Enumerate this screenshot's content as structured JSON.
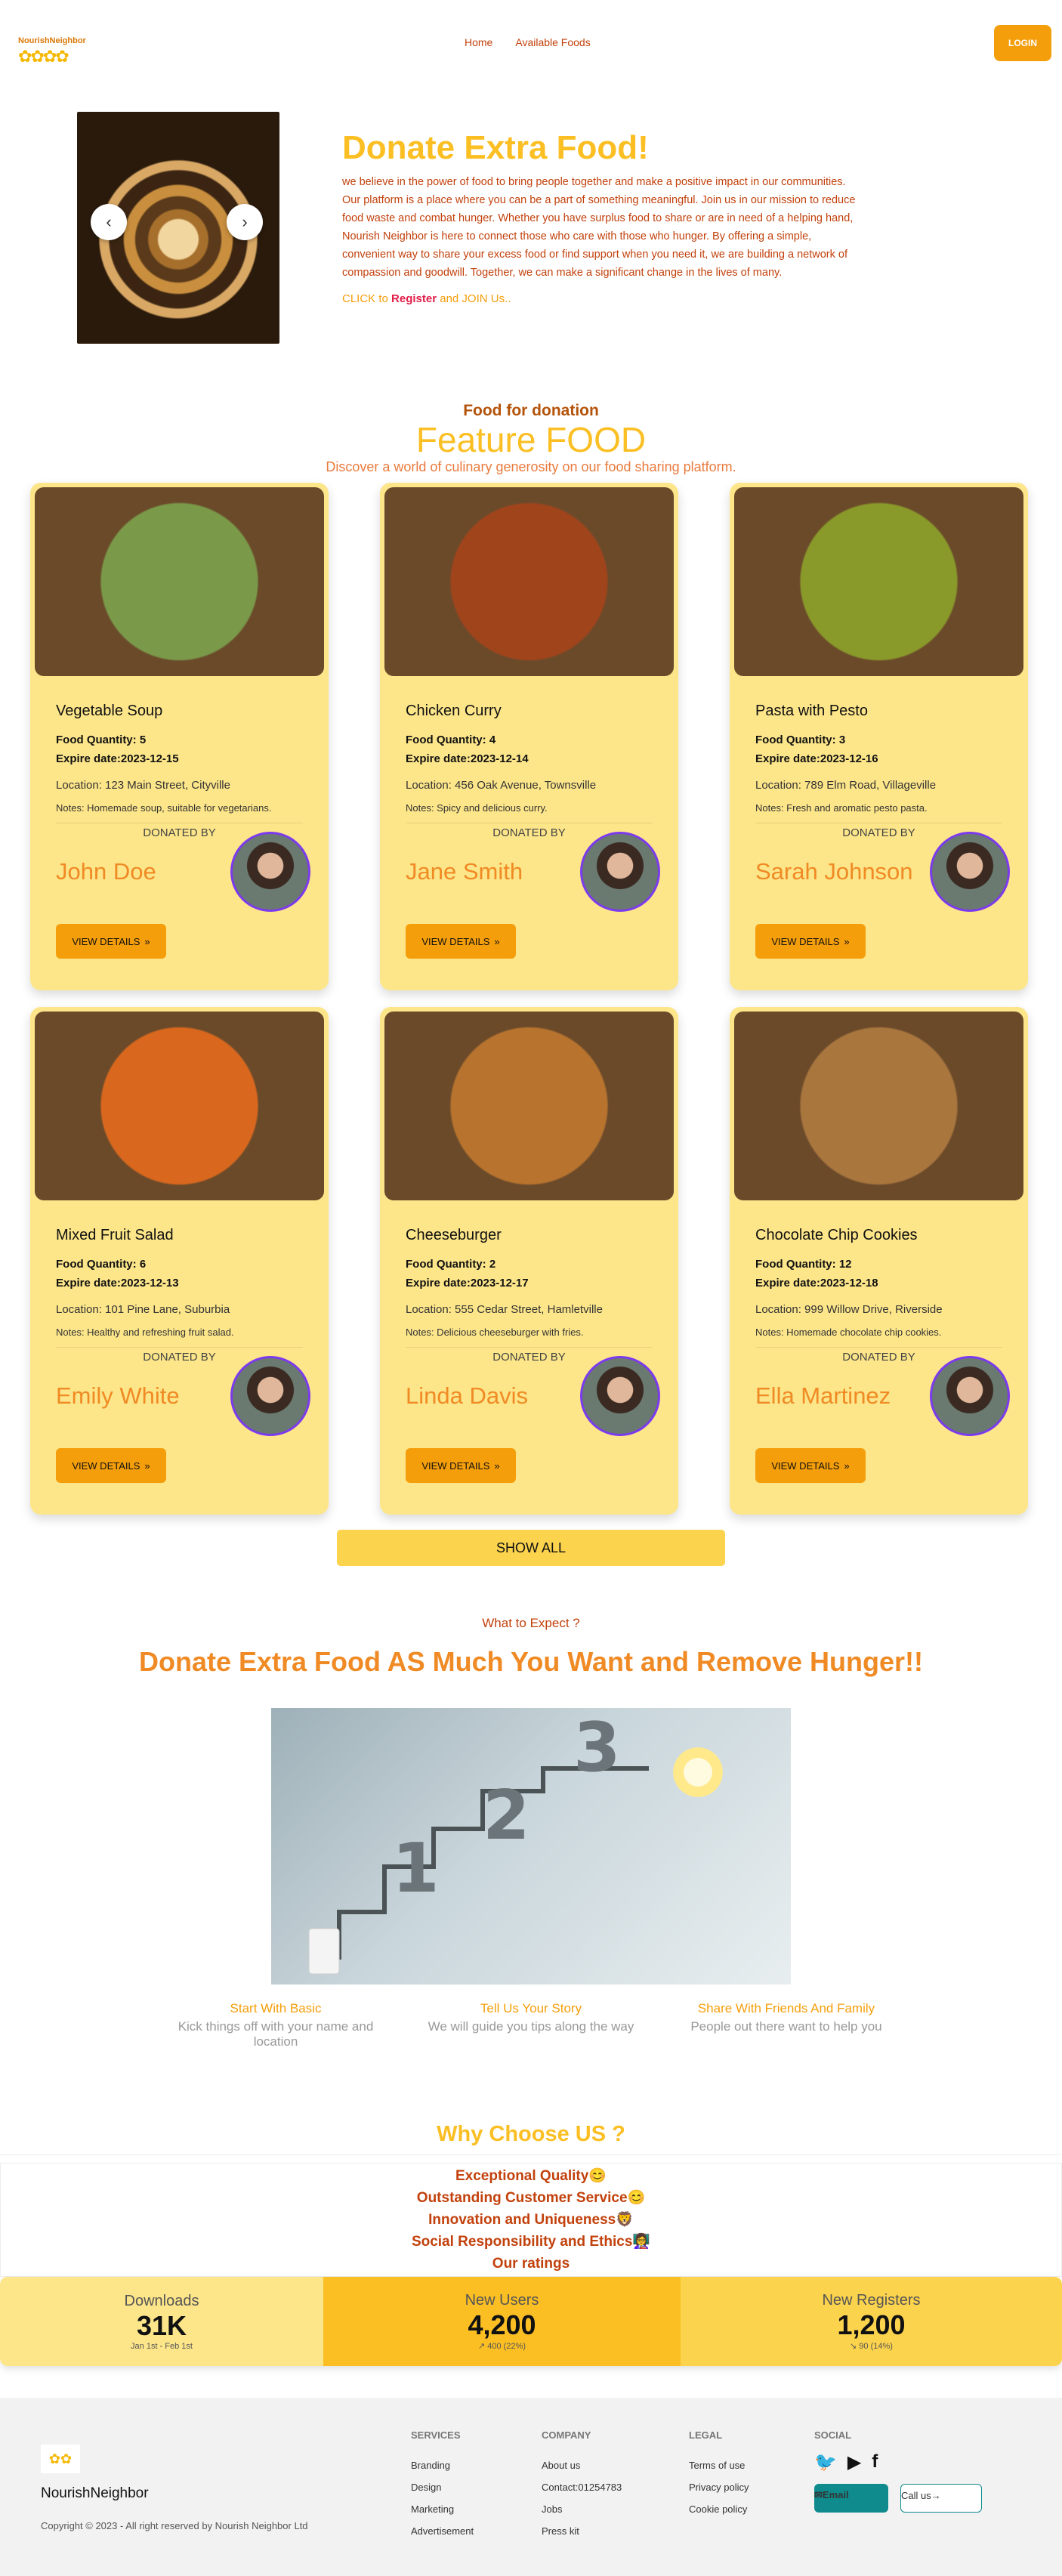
{
  "nav": {
    "logo_text": "NourishNeighbor",
    "links": [
      "Home",
      "Available Foods"
    ],
    "login_label": "LOGIN"
  },
  "hero": {
    "prev": "‹",
    "next": "›",
    "title": "Donate Extra Food!",
    "paragraph": "we believe in the power of food to bring people together and make a positive impact in our communities. Our platform is a place where you can be a part of something meaningful. Join us in our mission to reduce food waste and combat hunger. Whether you have surplus food to share or are in need of a helping hand, Nourish Neighbor is here to connect those who care with those who hunger. By offering a simple, convenient way to share your excess food or find support when you need it, we are building a network of compassion and goodwill. Together, we can make a significant change in the lives of many.",
    "cta_prefix": "CLICK to ",
    "cta_register": "Register",
    "cta_suffix": " and JOIN Us.."
  },
  "featured": {
    "kicker": "Food for donation",
    "title": "Feature FOOD",
    "description": "Discover a world of culinary generosity on our food sharing platform.",
    "donated_by_label": "DONATED BY",
    "view_details_label": "VIEW DETAILS",
    "show_all_label": "SHOW ALL",
    "foods": [
      {
        "name": "Vegetable Soup",
        "quantity": "5",
        "expire": "2023-12-15",
        "location": "Location: 123 Main Street, Cityville",
        "notes": "Notes: Homemade soup, suitable for vegetarians.",
        "donor": "John Doe",
        "img_color": "#7a9a4a"
      },
      {
        "name": "Chicken Curry",
        "quantity": "4",
        "expire": "2023-12-14",
        "location": "Location: 456 Oak Avenue, Townsville",
        "notes": "Notes: Spicy and delicious curry.",
        "donor": "Jane Smith",
        "img_color": "#a0441c"
      },
      {
        "name": "Pasta with Pesto",
        "quantity": "3",
        "expire": "2023-12-16",
        "location": "Location: 789 Elm Road, Villageville",
        "notes": "Notes: Fresh and aromatic pesto pasta.",
        "donor": "Sarah Johnson",
        "img_color": "#8a9a2a"
      },
      {
        "name": "Mixed Fruit Salad",
        "quantity": "6",
        "expire": "2023-12-13",
        "location": "Location: 101 Pine Lane, Suburbia",
        "notes": "Notes: Healthy and refreshing fruit salad.",
        "donor": "Emily White",
        "img_color": "#d9681e"
      },
      {
        "name": "Cheeseburger",
        "quantity": "2",
        "expire": "2023-12-17",
        "location": "Location: 555 Cedar Street, Hamletville",
        "notes": "Notes: Delicious cheeseburger with fries.",
        "donor": "Linda Davis",
        "img_color": "#b8742e"
      },
      {
        "name": "Chocolate Chip Cookies",
        "quantity": "12",
        "expire": "2023-12-18",
        "location": "Location: 999 Willow Drive, Riverside",
        "notes": "Notes: Homemade chocolate chip cookies.",
        "donor": "Ella Martinez",
        "img_color": "#a9763e"
      }
    ]
  },
  "expect": {
    "kicker": "What to Expect ?",
    "title": "Donate Extra Food AS Much You Want and Remove Hunger!!",
    "steps": [
      {
        "title": "Start With Basic",
        "desc": "Kick things off with your name and location"
      },
      {
        "title": "Tell Us Your Story",
        "desc": "We will guide you tips along the way"
      },
      {
        "title": "Share With Friends And Family",
        "desc": "People out there want to help you"
      }
    ]
  },
  "why": {
    "title": "Why Choose US ?",
    "items": [
      "Exceptional Quality😊",
      "Outstanding Customer Service😊",
      "Innovation and Uniqueness🦁",
      "Social Responsibility and Ethics👩‍🏫",
      "Our ratings"
    ],
    "stats": [
      {
        "title": "Downloads",
        "value": "31K",
        "desc": "Jan 1st - Feb 1st"
      },
      {
        "title": "New Users",
        "value": "4,200",
        "desc": "↗︎ 400 (22%)"
      },
      {
        "title": "New Registers",
        "value": "1,200",
        "desc": "↘︎ 90 (14%)"
      }
    ]
  },
  "footer": {
    "brand": "NourishNeighbor",
    "copyright": "Copyright © 2023 - All right reserved by Nourish Neighbor Ltd",
    "services": {
      "title": "SERVICES",
      "links": [
        "Branding",
        "Design",
        "Marketing",
        "Advertisement"
      ]
    },
    "company": {
      "title": "COMPANY",
      "links": [
        "About us",
        "Contact:01254783",
        "Jobs",
        "Press kit"
      ]
    },
    "legal": {
      "title": "LEGAL",
      "links": [
        "Terms of use",
        "Privacy policy",
        "Cookie policy"
      ]
    },
    "social": {
      "title": "SOCIAL",
      "email_label": "Email",
      "call_label": "Call us"
    }
  }
}
